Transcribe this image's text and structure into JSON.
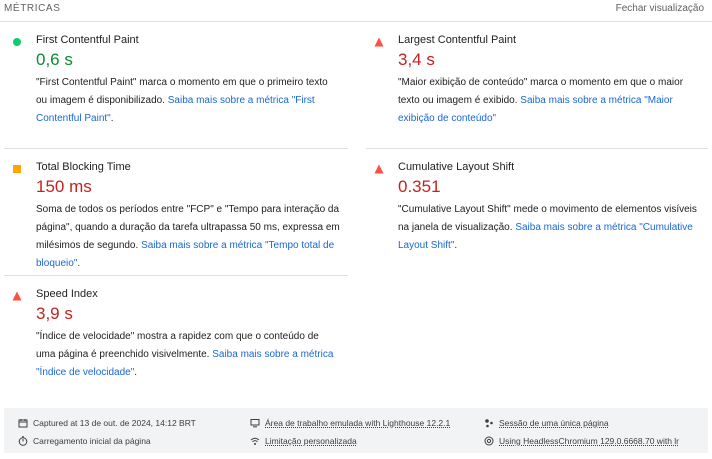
{
  "header": {
    "title": "MÉTRICAS",
    "toggle": "Fechar visualização"
  },
  "metrics": [
    {
      "name": "First Contentful Paint",
      "value": "0,6 s",
      "status": "good",
      "icon": "circle-icon",
      "desc_pre": "\"First Contentful Paint\" marca o momento em que o primeiro texto ou imagem é disponibilizado.",
      "link": "Saiba mais sobre a métrica \"First Contentful Paint\"",
      "desc_post": "."
    },
    {
      "name": "Largest Contentful Paint",
      "value": "3,4 s",
      "status": "bad",
      "icon": "triangle-icon",
      "desc_pre": "\"Maior exibição de conteúdo\" marca o momento em que o maior texto ou imagem é exibido.",
      "link": "Saiba mais sobre a métrica \"Maior exibição de conteúdo\"",
      "desc_post": ""
    },
    {
      "name": "Total Blocking Time",
      "value": "150 ms",
      "status": "average",
      "icon": "square-icon",
      "desc_pre": "Soma de todos os períodos entre \"FCP\" e \"Tempo para interação da página\", quando a duração da tarefa ultrapassa 50 ms, expressa em milésimos de segundo.",
      "link": "Saiba mais sobre a métrica \"Tempo total de bloqueio\"",
      "desc_post": "."
    },
    {
      "name": "Cumulative Layout Shift",
      "value": "0.351",
      "status": "bad",
      "icon": "triangle-icon",
      "desc_pre": "\"Cumulative Layout Shift\" mede o movimento de elementos visíveis na janela de visualização.",
      "link": "Saiba mais sobre a métrica \"Cumulative Layout Shift\"",
      "desc_post": "."
    },
    {
      "name": "Speed Index",
      "value": "3,9 s",
      "status": "bad",
      "icon": "triangle-icon",
      "desc_pre": "\"Índice de velocidade\" mostra a rapidez com que o conteúdo de uma página é preenchido visivelmente.",
      "link": "Saiba mais sobre a métrica \"Índice de velocidade\"",
      "desc_post": "."
    }
  ],
  "footer": {
    "captured": "Captured at 13 de out. de 2024, 14:12 BRT",
    "initial_load": "Carregamento inicial da página",
    "emulated": "Área de trabalho emulada with Lighthouse 12.2.1",
    "throttling": "Limitação personalizada",
    "session": "Sessão de uma única página",
    "browser": "Using HeadlessChromium 129.0.6668.70 with lr"
  },
  "colors": {
    "good": "#0c8a30",
    "average": "#f2a53c",
    "bad": "#e8312a",
    "link": "#1967d2"
  }
}
